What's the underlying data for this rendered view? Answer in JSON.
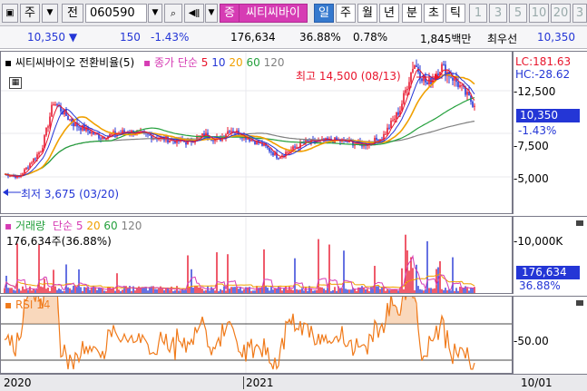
{
  "toolbar": {
    "prefix": "주",
    "code_label": "전",
    "code_value": "060590",
    "market_tag": "증",
    "stock_name": "씨티씨바이",
    "periods": [
      "일",
      "주",
      "월",
      "년",
      "분",
      "초",
      "틱"
    ],
    "numbers": [
      "1",
      "3",
      "5",
      "10",
      "20",
      "3"
    ]
  },
  "quote": {
    "price": "10,350",
    "change": "150",
    "change_pct": "-1.43%",
    "volume": "176,634",
    "vol_pct": "36.88%",
    "turnover": "0.78%",
    "amount": "1,845백만",
    "best_label": "최우선",
    "best_value": "10,350"
  },
  "price_panel": {
    "legend_name": "씨티씨바이오 전환비율(5)",
    "ma_label": "종가 단순",
    "ma_periods": [
      "5",
      "10",
      "20",
      "60",
      "120"
    ],
    "high_note": "최고 14,500 (08/13)",
    "low_note": "최저 3,675 (03/20)",
    "scale": [
      "12,500",
      "10,000",
      "7,500",
      "5,000"
    ],
    "lc": "LC:181.63",
    "hc": "HC:-28.62",
    "current": "10,350",
    "current_pct": "-1.43%"
  },
  "volume_panel": {
    "title": "거래량",
    "ma_label": "단순",
    "ma_periods": [
      "5",
      "20",
      "60",
      "120"
    ],
    "value_text": "176,634주(36.88%)",
    "scale_top": "10,000K",
    "current": "176,634",
    "current_pct": "36.88%"
  },
  "rsi_panel": {
    "title": "RSI 14",
    "scale": "50.00"
  },
  "xaxis": {
    "labels": [
      "2020",
      "2021"
    ],
    "right_label": "10/01"
  },
  "colors": {
    "up": "#e8152c",
    "down": "#2436d6",
    "ma5": "#e8152c",
    "ma10": "#2436d6",
    "ma20": "#f0a000",
    "ma60": "#24a03c",
    "ma120": "#808080",
    "rsi": "#f07a1a",
    "selected": "#3579ce"
  }
}
